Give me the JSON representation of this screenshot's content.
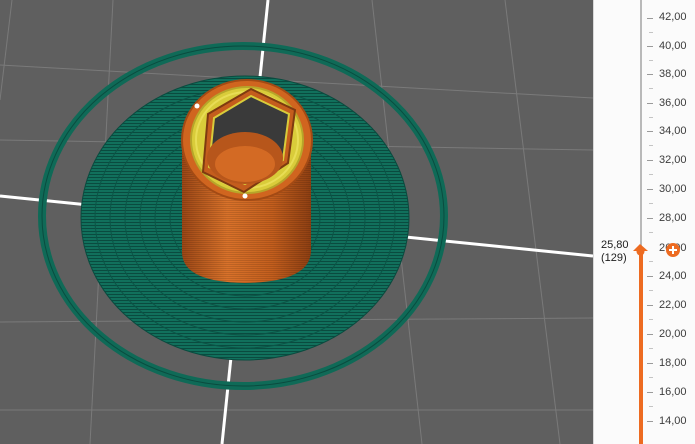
{
  "slider": {
    "ticks": [
      "42,00",
      "40,00",
      "38,00",
      "36,00",
      "34,00",
      "32,00",
      "30,00",
      "28,00",
      "26,00",
      "24,00",
      "22,00",
      "20,00",
      "18,00",
      "16,00",
      "14,00"
    ],
    "current_height": "25,80",
    "current_layer": "(129)"
  },
  "colors": {
    "bed_background": "#5e5e5e",
    "bed_grid": "#ffffff",
    "skirt": "#0f6a57",
    "object_wall": "#c9601d",
    "infill": "#d6cf3a",
    "accent": "#ed6b21"
  }
}
